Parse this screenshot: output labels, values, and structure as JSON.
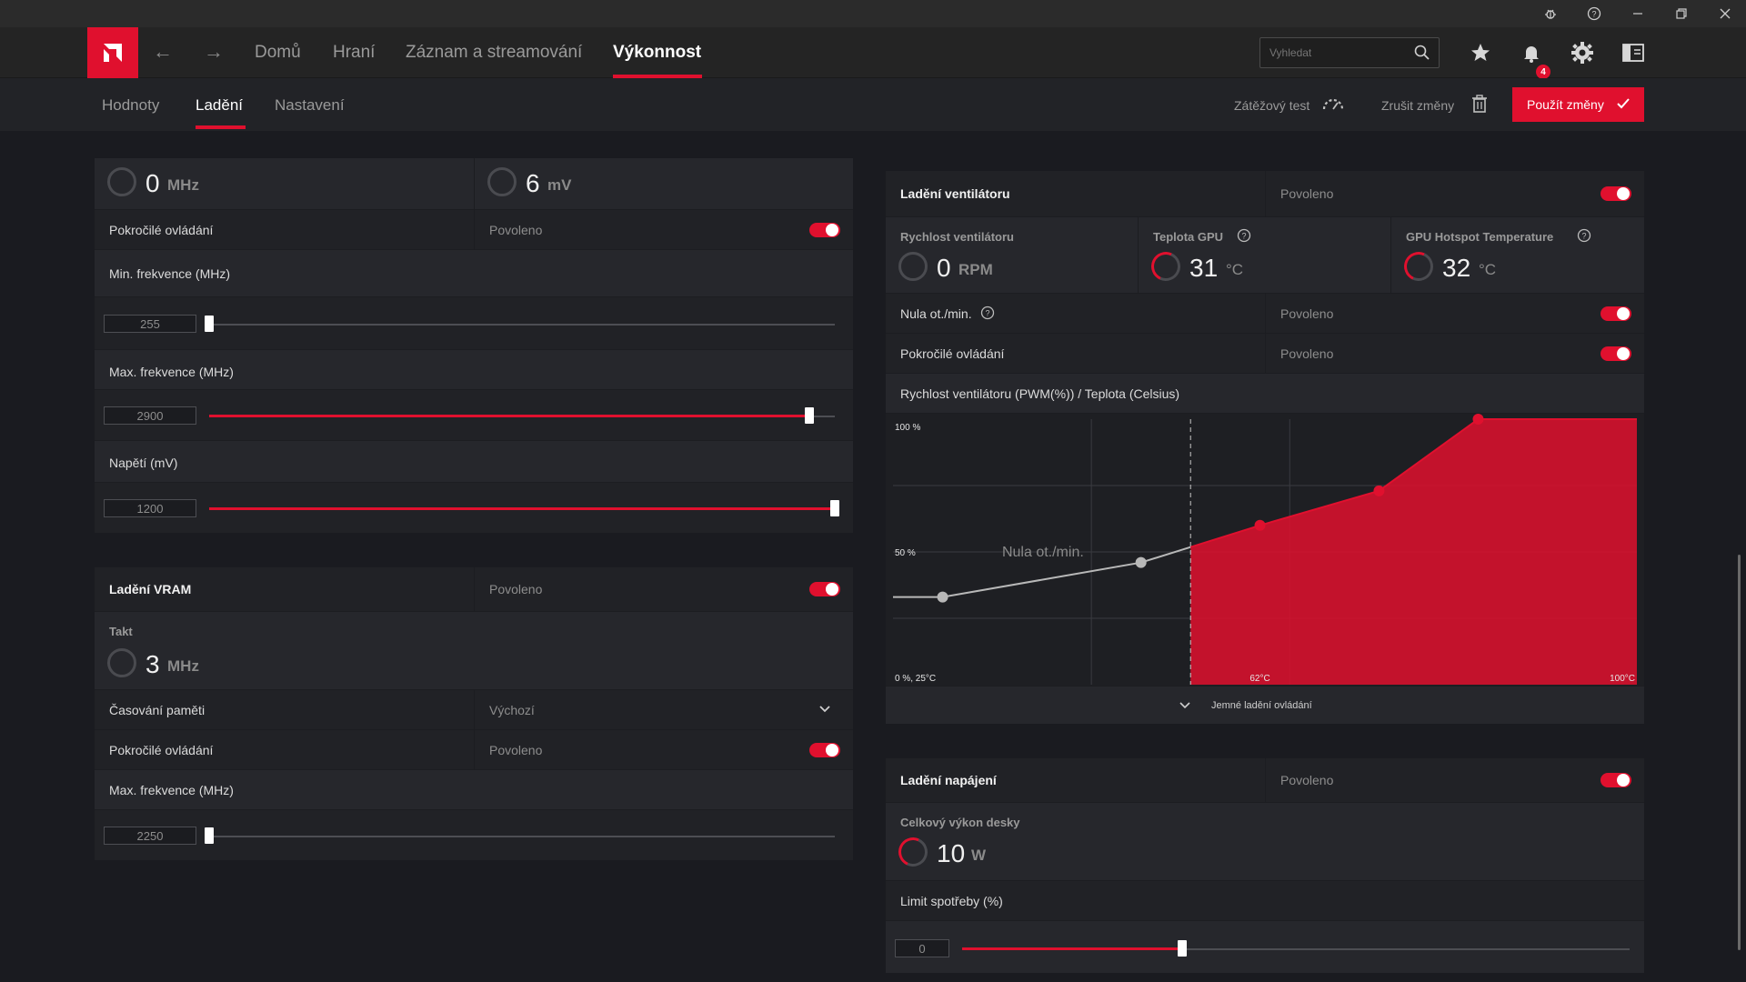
{
  "window": {
    "controls": [
      "bug-icon",
      "help-icon",
      "minimize-icon",
      "restore-icon",
      "close-icon"
    ]
  },
  "nav": {
    "items": [
      "Domů",
      "Hraní",
      "Záznam a streamování",
      "Výkonnost"
    ],
    "active": "Výkonnost",
    "search_placeholder": "Vyhledat",
    "notification_count": "4"
  },
  "subnav": {
    "tabs": [
      "Hodnoty",
      "Ladění",
      "Nastavení"
    ],
    "active": "Ladění",
    "stress_test": "Zátěžový test",
    "discard": "Zrušit změny",
    "apply": "Použít změny"
  },
  "gpu": {
    "clock_value": "0",
    "clock_unit": "MHz",
    "voltage_value": "6",
    "voltage_unit": "mV",
    "advanced_label": "Pokročilé ovládání",
    "advanced_state": "Povoleno",
    "min_freq_label": "Min. frekvence (MHz)",
    "min_freq_value": "255",
    "min_freq_level": 0.0,
    "max_freq_label": "Max. frekvence (MHz)",
    "max_freq_value": "2900",
    "max_freq_level": 0.96,
    "voltage_label": "Napětí (mV)",
    "voltage_slider_value": "1200",
    "voltage_level": 1.0
  },
  "vram": {
    "title": "Ladění VRAM",
    "state": "Povoleno",
    "clock_label": "Takt",
    "clock_value": "3",
    "clock_unit": "MHz",
    "timing_label": "Časování paměti",
    "timing_value": "Výchozí",
    "advanced_label": "Pokročilé ovládání",
    "advanced_state": "Povoleno",
    "max_freq_label": "Max. frekvence (MHz)",
    "max_freq_value": "2250",
    "max_freq_level": 0.0
  },
  "fan": {
    "title": "Ladění ventilátoru",
    "state": "Povoleno",
    "speed_label": "Rychlost ventilátoru",
    "speed_value": "0",
    "speed_unit": "RPM",
    "gpu_temp_label": "Teplota GPU",
    "gpu_temp_value": "31",
    "gpu_temp_unit": "°C",
    "hotspot_label": "GPU Hotspot Temperature",
    "hotspot_value": "32",
    "hotspot_unit": "°C",
    "zero_rpm_label": "Nula ot./min.",
    "zero_rpm_state": "Povoleno",
    "advanced_label": "Pokročilé ovládání",
    "advanced_state": "Povoleno",
    "curve_title": "Rychlost ventilátoru (PWM(%)) / Teplota (Celsius)",
    "fine_tune": "Jemné ladění ovládání"
  },
  "chart_data": {
    "type": "area",
    "title": "Rychlost ventilátoru (PWM(%)) / Teplota (Celsius)",
    "xlabel": "",
    "ylabel": "",
    "xlim": [
      25,
      100
    ],
    "ylim": [
      0,
      100
    ],
    "tick_labels": {
      "top_left": "100 %",
      "mid_left": "50 %",
      "origin": "0 %, 25°C",
      "x_mid": "62°C",
      "x_max": "100°C"
    },
    "zero_rpm_label": "Nula ot./min.",
    "zero_rpm_threshold": 55,
    "series": [
      {
        "points": [
          [
            30,
            33
          ],
          [
            50,
            46
          ],
          [
            62,
            60
          ],
          [
            74,
            73
          ],
          [
            84,
            100
          ],
          [
            100,
            100
          ]
        ]
      }
    ],
    "accent": "#e0102e",
    "grid": true
  },
  "power": {
    "title": "Ladění napájení",
    "state": "Povoleno",
    "board_power_label": "Celkový výkon desky",
    "board_power_value": "10",
    "board_power_unit": "W",
    "limit_label": "Limit spotřeby (%)",
    "limit_value": "0",
    "limit_level": 0.33
  },
  "colors": {
    "accent": "#e0102e",
    "background": "#1a1b20",
    "panel": "#26272c"
  }
}
